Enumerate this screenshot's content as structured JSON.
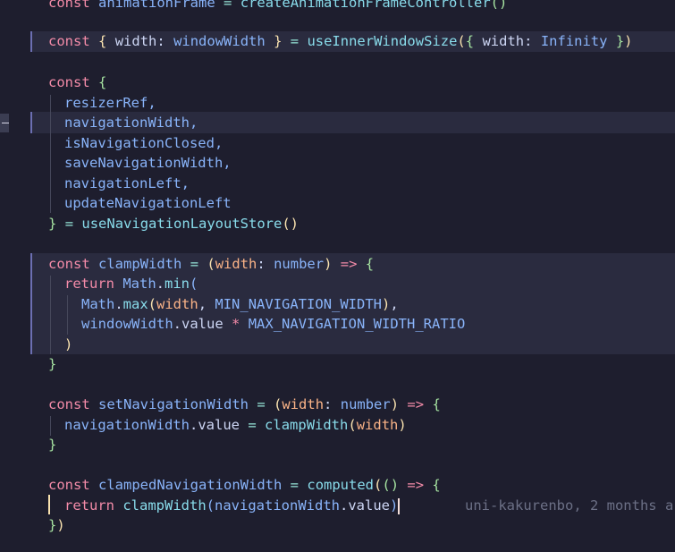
{
  "code": {
    "l0": {
      "kw": "const",
      "name": "animationFrame",
      "eq": "=",
      "fn": "createAnimationFrameController",
      "args": "()"
    },
    "l1": {
      "kw": "const",
      "open": "{",
      "prop": "width",
      "colon": ":",
      "alias": "windowWidth",
      "close": "}",
      "eq": "=",
      "fn": "useInnerWindowSize",
      "p_open": "(",
      "b_open": "{",
      "arg_prop": "width",
      "arg_colon": ":",
      "arg_val": "Infinity",
      "b_close": "}",
      "p_close": ")"
    },
    "l2": {
      "kw": "const",
      "open": "{"
    },
    "l3": "resizerRef,",
    "l4": "navigationWidth,",
    "l5": "isNavigationClosed,",
    "l6": "saveNavigationWidth,",
    "l7": "navigationLeft,",
    "l8": "updateNavigationLeft",
    "l9": {
      "close": "}",
      "eq": "=",
      "fn": "useNavigationLayoutStore",
      "args": "()"
    },
    "l10": {
      "kw": "const",
      "name": "clampWidth",
      "eq": "=",
      "p_open": "(",
      "param": "width",
      "colon": ":",
      "type": "number",
      "p_close": ")",
      "arrow": "=>",
      "open": "{"
    },
    "l11": {
      "kw": "return",
      "obj": "Math",
      "dot": ".",
      "fn": "min",
      "open": "("
    },
    "l12": {
      "obj": "Math",
      "dot": ".",
      "fn": "max",
      "open": "(",
      "arg1": "width",
      "comma": ",",
      "arg2": "MIN_NAVIGATION_WIDTH",
      "close": ")",
      "tail": ","
    },
    "l13": {
      "obj": "windowWidth",
      "dot": ".",
      "prop": "value",
      "op": "*",
      "const": "MAX_NAVIGATION_WIDTH_RATIO"
    },
    "l14": ")",
    "l15": "}",
    "l16": {
      "kw": "const",
      "name": "setNavigationWidth",
      "eq": "=",
      "p_open": "(",
      "param": "width",
      "colon": ":",
      "type": "number",
      "p_close": ")",
      "arrow": "=>",
      "open": "{"
    },
    "l17": {
      "obj": "navigationWidth",
      "dot": ".",
      "prop": "value",
      "eq": "=",
      "fn": "clampWidth",
      "open": "(",
      "arg": "width",
      "close": ")"
    },
    "l18": "}",
    "l19": {
      "kw": "const",
      "name": "clampedNavigationWidth",
      "eq": "=",
      "fn": "computed",
      "open": "(",
      "inner": "()",
      "arrow": "=>",
      "brace": "{"
    },
    "l20": {
      "kw": "return",
      "fn": "clampWidth",
      "open": "(",
      "obj": "navigationWidth",
      "dot": ".",
      "prop": "value",
      "close": ")"
    },
    "l21": {
      "close_brace": "}",
      "close_paren": ")"
    }
  },
  "blame": "uni-kakurenbo, 2 months a",
  "colors": {
    "background": "#1e1e2e",
    "keyword": "#f38ba8",
    "variable": "#89b4fa",
    "function": "#89dceb",
    "parameter": "#fab387",
    "text": "#cdd6f4"
  }
}
